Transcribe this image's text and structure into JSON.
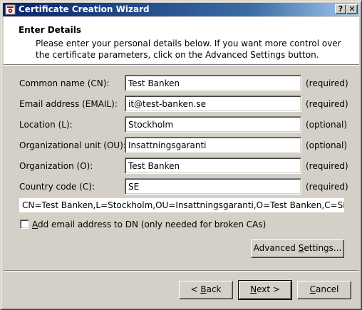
{
  "window": {
    "title": "Certificate Creation Wizard",
    "help_glyph": "?",
    "close_glyph": "✕"
  },
  "header": {
    "title": "Enter Details",
    "description": "Please enter your personal details below. If you want more control over the certificate parameters, click on the Advanced Settings button."
  },
  "fields": [
    {
      "label": "Common name (CN):",
      "value": "Test Banken",
      "status": "(required)"
    },
    {
      "label": "Email address (EMAIL):",
      "value": "it@test-banken.se",
      "status": "(required)"
    },
    {
      "label": "Location (L):",
      "value": "Stockholm",
      "status": "(optional)"
    },
    {
      "label": "Organizational unit (OU):",
      "value": "Insattningsgaranti",
      "status": "(optional)"
    },
    {
      "label": "Organization (O):",
      "value": "Test Banken",
      "status": "(required)"
    },
    {
      "label": "Country code (C):",
      "value": "SE",
      "status": "(required)"
    }
  ],
  "dn_preview": "CN=Test Banken,L=Stockholm,OU=Insattningsgaranti,O=Test Banken,C=SE",
  "checkbox": {
    "label_accel": "A",
    "label_rest": "dd email address to DN (only needed for broken CAs)",
    "checked": false
  },
  "advanced_button": {
    "label_pre": "Advanced ",
    "label_accel": "S",
    "label_post": "ettings..."
  },
  "back_button": {
    "label_pre": "< ",
    "label_accel": "B",
    "label_post": "ack"
  },
  "next_button": {
    "label_accel": "N",
    "label_post": "ext >"
  },
  "cancel_button": {
    "label_accel": "C",
    "label_post": "ancel"
  },
  "colors": {
    "titlebar_start": "#0a246a",
    "titlebar_end": "#a6caf0",
    "face": "#d4d0c8"
  },
  "icons": {
    "app": "certificate-icon"
  }
}
